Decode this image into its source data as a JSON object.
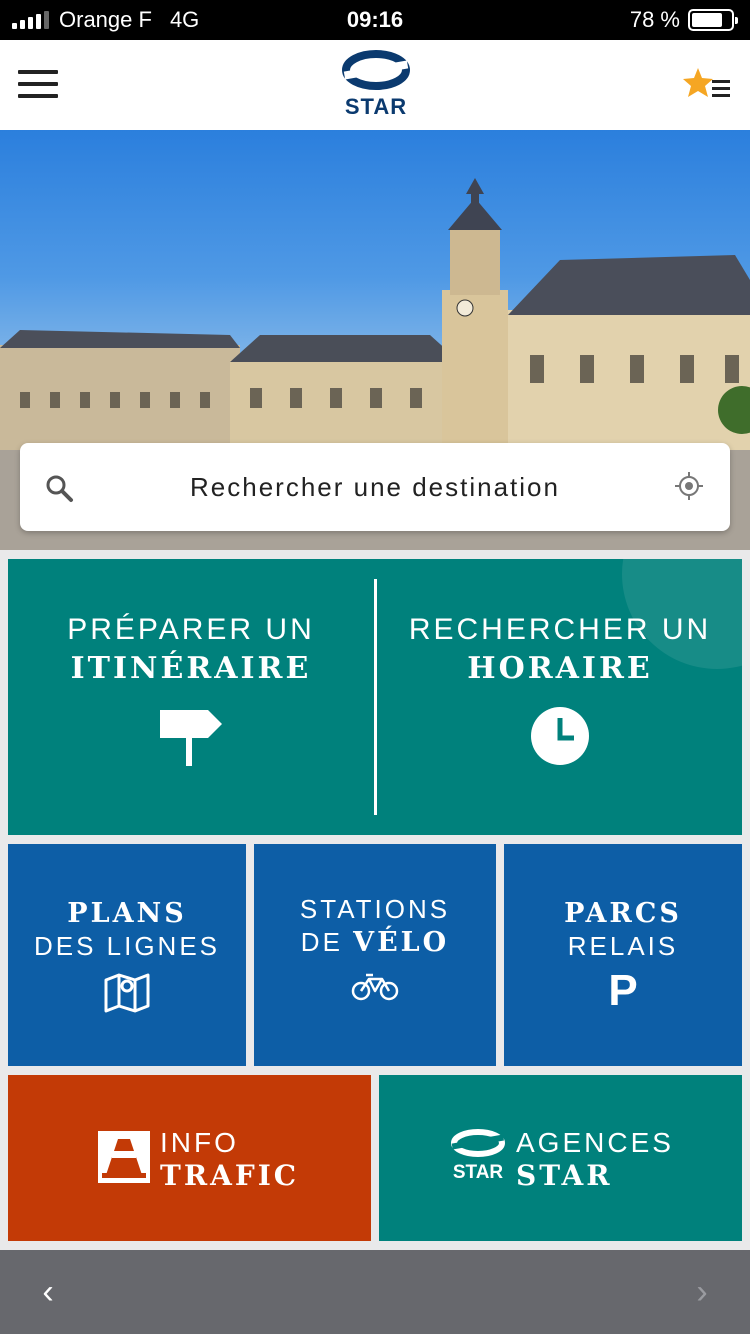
{
  "status_bar": {
    "carrier": "Orange F",
    "network": "4G",
    "time": "09:16",
    "battery": "78 %"
  },
  "header": {
    "logo_text": "STAR"
  },
  "search": {
    "placeholder": "Rechercher une destination"
  },
  "tiles": {
    "itineraire": {
      "line1": "PRÉPARER UN",
      "line2": "ITINÉRAIRE"
    },
    "horaire": {
      "line1": "RECHERCHER UN",
      "line2": "HORAIRE"
    },
    "plans": {
      "line1": "PLANS",
      "line2": "DES LIGNES"
    },
    "velo": {
      "line1": "STATIONS",
      "line2a": "DE ",
      "line2b": "VÉLO"
    },
    "parcs": {
      "line1": "PARCS",
      "line2": "RELAIS",
      "icon_text": "P"
    },
    "info": {
      "line1": "INFO",
      "line2": "TRAFIC"
    },
    "agences": {
      "logo_text": "STAR",
      "line1": "AGENCES",
      "line2": "STAR"
    }
  },
  "footer": {
    "prev": "‹",
    "next": "›"
  },
  "colors": {
    "teal": "#00817c",
    "blue": "#0d5ea6",
    "orange": "#c33a06",
    "navy": "#0b3a6f",
    "star": "#f5a623"
  }
}
